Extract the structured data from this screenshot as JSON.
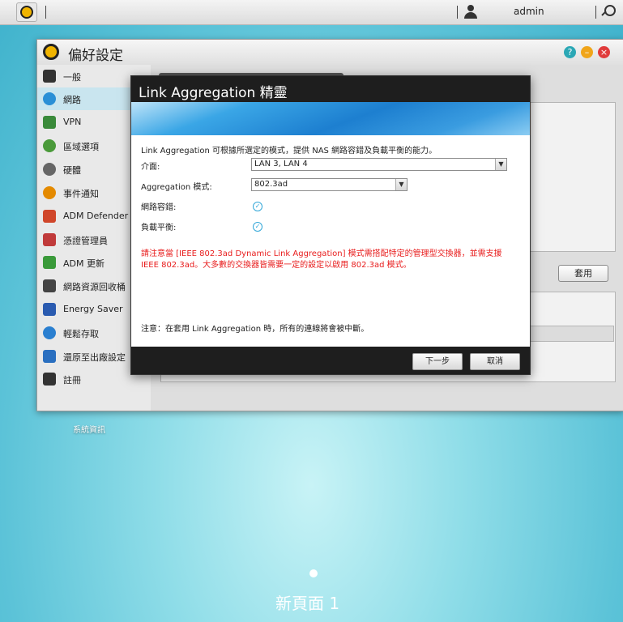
{
  "taskbar": {
    "user": "admin"
  },
  "window": {
    "title": "偏好設定",
    "sidebar": [
      {
        "label": "一般",
        "icon": "monitor-icon",
        "color": "#333333"
      },
      {
        "label": "網路",
        "icon": "globe-icon",
        "color": "#2a8fd6"
      },
      {
        "label": "VPN",
        "icon": "vpn-icon",
        "color": "#3a8a3a"
      },
      {
        "label": "區域選項",
        "icon": "region-icon",
        "color": "#4a9a3a"
      },
      {
        "label": "硬體",
        "icon": "hardware-icon",
        "color": "#666666"
      },
      {
        "label": "事件通知",
        "icon": "alert-icon",
        "color": "#e48a00"
      },
      {
        "label": "ADM Defender",
        "icon": "defender-icon",
        "color": "#d0462a"
      },
      {
        "label": "憑證管理員",
        "icon": "certificate-icon",
        "color": "#c03a3a"
      },
      {
        "label": "ADM 更新",
        "icon": "update-arrow-icon",
        "color": "#3a9a3a"
      },
      {
        "label": "網路資源回收桶",
        "icon": "recycle-bin-icon",
        "color": "#444444"
      },
      {
        "label": "Energy Saver",
        "icon": "energy-icon",
        "color": "#2a5bb0"
      },
      {
        "label": "輕鬆存取",
        "icon": "cloud-access-icon",
        "color": "#2a7fd0"
      },
      {
        "label": "還原至出廠設定",
        "icon": "restore-icon",
        "color": "#2a6fc0"
      },
      {
        "label": "註冊",
        "icon": "register-icon",
        "color": "#333333"
      }
    ],
    "apply_label": "套用"
  },
  "dialog": {
    "title": "Link Aggregation 精靈",
    "intro": "Link Aggregation 可根據所選定的模式，提供 NAS 網路容錯及負載平衡的能力。",
    "interface_label": "介面:",
    "interface_value": "LAN 3, LAN 4",
    "mode_label": "Aggregation 模式:",
    "mode_value": "802.3ad",
    "fault_tolerance_label": "網路容錯:",
    "load_balance_label": "負載平衡:",
    "warning_line1": "請注意當 [IEEE 802.3ad Dynamic Link Aggregation] 模式需搭配特定的管理型交換器，並需支援",
    "warning_line2": "IEEE 802.3ad。大多數的交換器皆需要一定的設定以啟用 802.3ad 模式。",
    "note": "注意：在套用 Link Aggregation 時，所有的連線將會被中斷。",
    "next_label": "下一步",
    "cancel_label": "取消"
  },
  "desktop": {
    "icon_label": "系統資訊",
    "page_label": "新頁面 1"
  }
}
